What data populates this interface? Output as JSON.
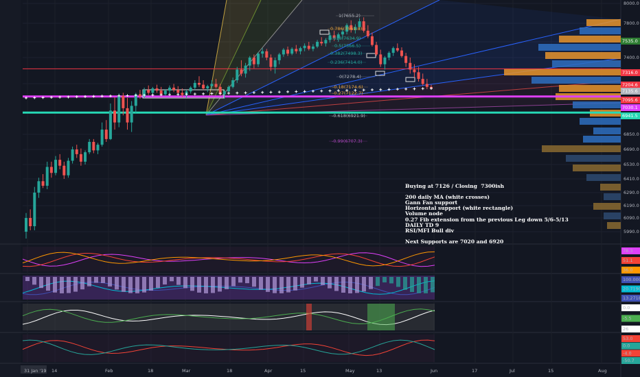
{
  "chart_data": {
    "type": "candlestick",
    "instrument_note": "Daily chart with Gann fan, Fibonacci levels, volume profile and indicator panes",
    "y_axis": {
      "ticks": [
        8000.0,
        7800.0,
        7600.0,
        7400.0,
        7204.6,
        7000.0,
        6850.0,
        6690.0,
        6530.0,
        6410.0,
        6290.0,
        6190.0,
        6090.0,
        5990.0
      ],
      "range": [
        5990.0,
        8000.0
      ]
    },
    "x_axis": {
      "ticks": [
        "Jan '19",
        "14",
        "Feb",
        "18",
        "Mar",
        "18",
        "Apr",
        "15",
        "May",
        "13",
        "Jun",
        "17",
        "Jul",
        "15",
        "Aug"
      ],
      "first_label_prefix": "31"
    },
    "price_tags": [
      {
        "value": "7316.0",
        "color": "#f23645"
      },
      {
        "value": "7204.6",
        "color": "#f23645"
      },
      {
        "value": "7135.6",
        "color": "#b2b5be"
      },
      {
        "value": "7095.6",
        "color": "#f23645"
      },
      {
        "value": "7030.1",
        "color": "#e040fb"
      },
      {
        "value": "6941.5",
        "color": "#26d8b4"
      },
      {
        "value": "7535.0",
        "color": "#2e7d32"
      }
    ],
    "fib_levels": [
      {
        "label": "1(7655.2)",
        "color": "#b2b5be"
      },
      {
        "label": "0.786(7561.8)",
        "color": "#e6a23c"
      },
      {
        "label": "0.618(7634.9)",
        "color": "#26a69a"
      },
      {
        "label": "0.5(7566.5)",
        "color": "#26a69a"
      },
      {
        "label": "0.382(7498.3)",
        "color": "#26a69a"
      },
      {
        "label": "0.236(7414.0)",
        "color": "#26a69a"
      },
      {
        "label": "0(7278.4)",
        "color": "#b2b5be"
      },
      {
        "label": "-0.18(7174.6)",
        "color": "#e6a23c"
      },
      {
        "label": "-0.27(7122.7)",
        "color": "#e6a23c"
      },
      {
        "label": "-0.618(6921.9)",
        "color": "#b2b5be"
      },
      {
        "label": "-0.99(6707.3)",
        "color": "#ab47bc"
      }
    ],
    "horizontal_lines": [
      {
        "value": 7316.0,
        "color": "#f23645"
      },
      {
        "value": 7030.1,
        "color": "#e040fb"
      },
      {
        "value": 6941.5,
        "color": "#26d8b4"
      }
    ],
    "candles": [
      [
        5990,
        6130,
        5940,
        6090
      ],
      [
        6090,
        6160,
        6000,
        6030
      ],
      [
        6030,
        6340,
        6000,
        6290
      ],
      [
        6290,
        6420,
        6250,
        6390
      ],
      [
        6390,
        6450,
        6330,
        6350
      ],
      [
        6350,
        6560,
        6320,
        6510
      ],
      [
        6510,
        6560,
        6420,
        6460
      ],
      [
        6460,
        6620,
        6440,
        6580
      ],
      [
        6580,
        6640,
        6490,
        6520
      ],
      [
        6520,
        6560,
        6410,
        6440
      ],
      [
        6440,
        6600,
        6420,
        6570
      ],
      [
        6570,
        6720,
        6540,
        6690
      ],
      [
        6690,
        6740,
        6600,
        6640
      ],
      [
        6640,
        6700,
        6520,
        6560
      ],
      [
        6560,
        6680,
        6530,
        6660
      ],
      [
        6660,
        6800,
        6640,
        6770
      ],
      [
        6770,
        6800,
        6650,
        6680
      ],
      [
        6680,
        6760,
        6640,
        6740
      ],
      [
        6740,
        6900,
        6720,
        6870
      ],
      [
        6870,
        6910,
        6770,
        6800
      ],
      [
        6800,
        6980,
        6790,
        6950
      ],
      [
        6950,
        7020,
        6870,
        6900
      ],
      [
        6900,
        7070,
        6880,
        7040
      ],
      [
        7040,
        7080,
        6930,
        6960
      ],
      [
        6960,
        7010,
        6870,
        6900
      ],
      [
        6900,
        6990,
        6860,
        6970
      ],
      [
        6970,
        7080,
        6940,
        7060
      ],
      [
        7060,
        7120,
        7000,
        7030
      ],
      [
        7030,
        7150,
        7010,
        7120
      ],
      [
        7120,
        7180,
        7050,
        7080
      ],
      [
        7080,
        7160,
        7050,
        7140
      ],
      [
        7140,
        7190,
        7080,
        7110
      ],
      [
        7110,
        7160,
        7030,
        7060
      ],
      [
        7060,
        7130,
        7040,
        7110
      ],
      [
        7110,
        7180,
        7070,
        7150
      ],
      [
        7150,
        7200,
        7090,
        7120
      ],
      [
        7120,
        7170,
        7050,
        7080
      ],
      [
        7080,
        7140,
        7020,
        7050
      ],
      [
        7050,
        7120,
        7010,
        7100
      ],
      [
        7100,
        7170,
        7070,
        7150
      ],
      [
        7150,
        7230,
        7120,
        7210
      ],
      [
        7210,
        7260,
        7160,
        7190
      ],
      [
        7190,
        7230,
        7120,
        7140
      ],
      [
        7140,
        7190,
        7090,
        7170
      ],
      [
        7170,
        7230,
        7130,
        7200
      ],
      [
        7200,
        7240,
        7140,
        7160
      ],
      [
        7160,
        7200,
        7040,
        7060
      ],
      [
        7060,
        7120,
        7000,
        7100
      ],
      [
        7100,
        7180,
        7080,
        7160
      ],
      [
        7160,
        7250,
        7140,
        7230
      ],
      [
        7230,
        7330,
        7210,
        7310
      ],
      [
        7310,
        7380,
        7260,
        7280
      ],
      [
        7280,
        7360,
        7250,
        7340
      ],
      [
        7340,
        7420,
        7300,
        7400
      ],
      [
        7400,
        7440,
        7320,
        7350
      ],
      [
        7350,
        7470,
        7330,
        7450
      ],
      [
        7450,
        7520,
        7400,
        7480
      ],
      [
        7480,
        7510,
        7380,
        7400
      ],
      [
        7400,
        7440,
        7300,
        7330
      ],
      [
        7330,
        7400,
        7280,
        7380
      ],
      [
        7380,
        7460,
        7350,
        7440
      ],
      [
        7440,
        7520,
        7410,
        7500
      ],
      [
        7500,
        7540,
        7420,
        7450
      ],
      [
        7450,
        7530,
        7430,
        7510
      ],
      [
        7510,
        7560,
        7450,
        7480
      ],
      [
        7480,
        7540,
        7440,
        7520
      ],
      [
        7520,
        7580,
        7480,
        7550
      ],
      [
        7550,
        7600,
        7490,
        7510
      ],
      [
        7510,
        7570,
        7480,
        7540
      ],
      [
        7540,
        7620,
        7520,
        7600
      ],
      [
        7600,
        7650,
        7550,
        7580
      ],
      [
        7580,
        7640,
        7540,
        7620
      ],
      [
        7620,
        7700,
        7590,
        7670
      ],
      [
        7670,
        7720,
        7610,
        7640
      ],
      [
        7640,
        7700,
        7600,
        7680
      ],
      [
        7680,
        7740,
        7640,
        7710
      ],
      [
        7710,
        7800,
        7680,
        7780
      ],
      [
        7780,
        7830,
        7700,
        7730
      ],
      [
        7730,
        7790,
        7690,
        7760
      ],
      [
        7760,
        7850,
        7730,
        7820
      ],
      [
        7820,
        7860,
        7700,
        7720
      ],
      [
        7720,
        7780,
        7640,
        7660
      ],
      [
        7660,
        7700,
        7540,
        7560
      ],
      [
        7560,
        7600,
        7420,
        7440
      ],
      [
        7440,
        7500,
        7330,
        7350
      ],
      [
        7350,
        7420,
        7310,
        7400
      ],
      [
        7400,
        7480,
        7380,
        7460
      ],
      [
        7460,
        7540,
        7420,
        7520
      ],
      [
        7520,
        7580,
        7470,
        7490
      ],
      [
        7490,
        7530,
        7400,
        7420
      ],
      [
        7420,
        7460,
        7330,
        7360
      ],
      [
        7360,
        7400,
        7280,
        7310
      ],
      [
        7310,
        7350,
        7250,
        7290
      ],
      [
        7290,
        7330,
        7220,
        7240
      ],
      [
        7240,
        7280,
        7180,
        7200
      ],
      [
        7200,
        7240,
        7130,
        7160
      ],
      [
        7160,
        7190,
        7120,
        7135
      ]
    ],
    "volume_profile_note": "horizontal volume-by-price histogram on right side",
    "indicator_panes": [
      {
        "name": "RSI/MFI",
        "values": [
          "78.3",
          "51.1",
          "36.0"
        ]
      },
      {
        "name": "Histogram",
        "values": [
          "100.0000",
          "20.7190",
          "13.2718"
        ]
      },
      {
        "name": "Oscillator",
        "values": [
          "0.0",
          "-5.5",
          "26"
        ]
      },
      {
        "name": "Momentum",
        "values": [
          "53.0",
          "0.0",
          "-4.0",
          "-50.7"
        ]
      }
    ]
  },
  "annotation": {
    "lines": [
      "Buying at 7126 / Closing  7300ish",
      "",
      "200 daily MA (white crosses)",
      "Gann Fan support",
      "Horizontal support (white rectangle)",
      "Volume node",
      "0.27 Fib extension from the previous Leg down 5/6-5/13",
      "DAILY TD 9",
      "RSI/MFI Bull div",
      "",
      "Next Supports are 7020 and 6920"
    ]
  },
  "colors": {
    "background": "#131722",
    "up": "#26a69a",
    "down": "#ef5350",
    "ma": "#ffffff",
    "fan": "#2962ff"
  }
}
